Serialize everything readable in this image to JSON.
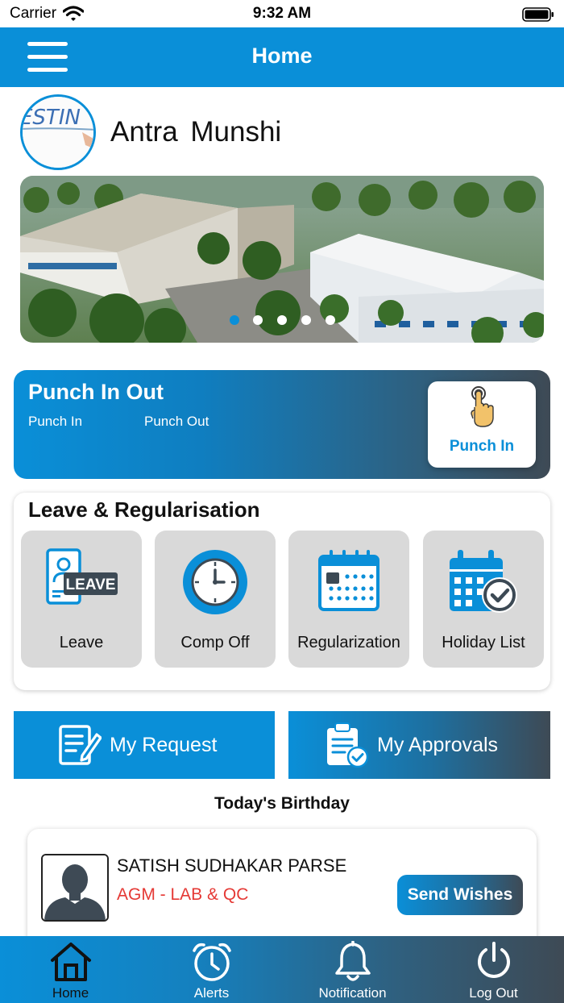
{
  "status_bar": {
    "carrier": "Carrier",
    "time": "9:32 AM"
  },
  "header": {
    "title": "Home",
    "menu_icon": "hamburger-menu-icon"
  },
  "profile": {
    "name": "Antra  Munshi",
    "avatar_text": "ESTIN"
  },
  "banner": {
    "slides": 5,
    "active_slide": 1
  },
  "punch": {
    "title": "Punch In Out",
    "punch_in_label": "Punch In",
    "punch_out_label": "Punch Out",
    "button_label": "Punch In"
  },
  "leave": {
    "title": "Leave & Regularisation",
    "leave_badge": "LEAVE",
    "tiles": [
      {
        "label": "Leave",
        "icon": "leave-document-icon"
      },
      {
        "label": "Comp Off",
        "icon": "clock-icon"
      },
      {
        "label": "Regularization",
        "icon": "calendar-grid-icon"
      },
      {
        "label": "Holiday List",
        "icon": "calendar-check-icon"
      }
    ]
  },
  "requests": {
    "my_request": "My Request",
    "my_approvals": "My Approvals"
  },
  "birthday": {
    "title": "Today's Birthday",
    "name": "SATISH SUDHAKAR PARSE",
    "role": "AGM - LAB & QC",
    "button": "Send Wishes"
  },
  "tabs": [
    {
      "label": "Home",
      "icon": "home-icon",
      "active": true
    },
    {
      "label": "Alerts",
      "icon": "alarm-clock-icon",
      "active": false
    },
    {
      "label": "Notification",
      "icon": "bell-icon",
      "active": false
    },
    {
      "label": "Log Out",
      "icon": "power-icon",
      "active": false
    }
  ],
  "colors": {
    "primary": "#0A8FD8",
    "dark": "#3E4A55",
    "tile_bg": "#D9D9D9",
    "role_red": "#E53935"
  }
}
